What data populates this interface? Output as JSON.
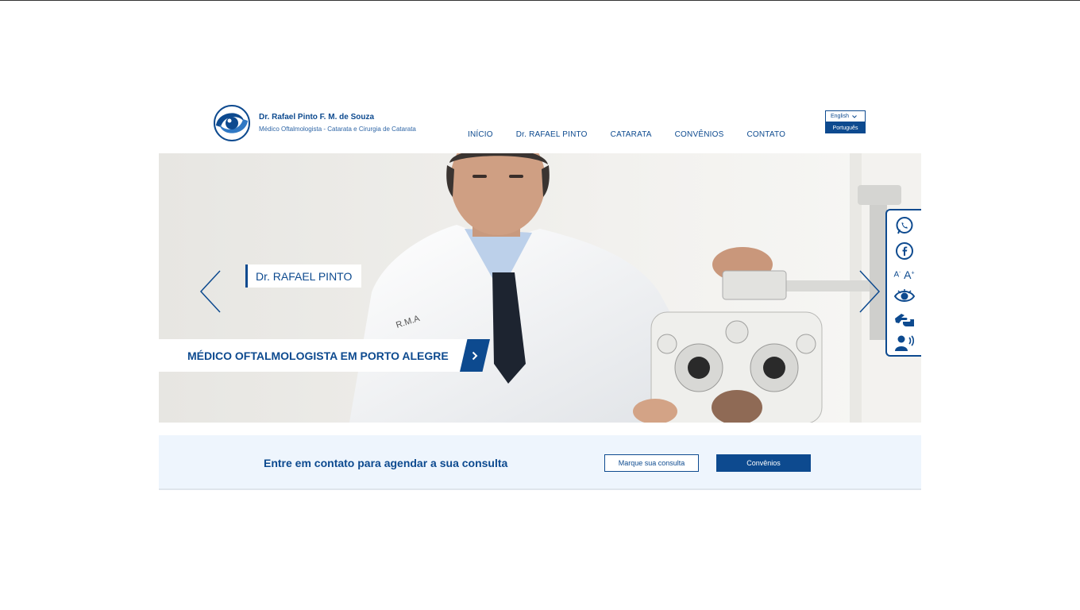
{
  "colors": {
    "brand": "#0d4a8f",
    "cta_background": "#eef5fd",
    "white": "#ffffff"
  },
  "header": {
    "logo_icon": "swirl-eye-logo",
    "name": "Dr. Rafael Pinto F. M. de Souza",
    "subtitle": "Médico Oftalmologista - Catarata e Cirurgia de Catarata"
  },
  "nav": {
    "items": [
      {
        "label": "INÍCIO"
      },
      {
        "label": "Dr. RAFAEL PINTO"
      },
      {
        "label": "CATARATA"
      },
      {
        "label": "CONVÊNIOS"
      },
      {
        "label": "CONTATO"
      }
    ]
  },
  "language": {
    "selected": "English",
    "option": "Português"
  },
  "hero": {
    "tag": "Dr. RAFAEL PINTO",
    "headline": "MÉDICO OFTALMOLOGISTA EM PORTO ALEGRE",
    "coat_logo": "R.M.A"
  },
  "accessibility": {
    "icons": [
      "whatsapp-icon",
      "facebook-icon",
      "font-size-icon",
      "contrast-eye-icon",
      "sign-language-icon",
      "screen-reader-icon"
    ],
    "font_small": "A",
    "font_large": "A"
  },
  "cta": {
    "text": "Entre em contato para agendar a sua consulta",
    "primary_button": "Marque sua consulta",
    "secondary_button": "Convênios"
  }
}
